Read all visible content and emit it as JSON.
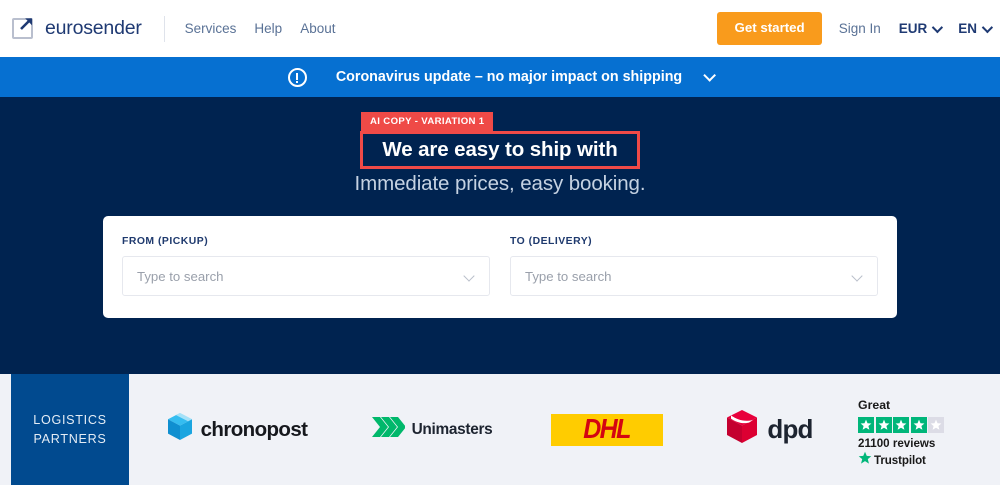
{
  "header": {
    "logo_text": "eurosender",
    "logo_icon": "arrow-out-of-box-icon",
    "nav": [
      {
        "label": "Services"
      },
      {
        "label": "Help"
      },
      {
        "label": "About"
      }
    ],
    "get_started_label": "Get started",
    "sign_in_label": "Sign In",
    "currency": {
      "value": "EUR",
      "icon": "chevron-down-icon"
    },
    "language": {
      "value": "EN",
      "icon": "chevron-down-icon"
    },
    "colors": {
      "cta": "#f99b1c",
      "brand_navy": "#1f3a73",
      "nav_link": "#5a7296"
    }
  },
  "banner": {
    "icon": "exclamation-circle-icon",
    "text": "Coronavirus update – no major impact on shipping",
    "expand_icon": "chevron-down-icon",
    "color": "#0670d1"
  },
  "hero": {
    "annotation_tag": "AI COPY - VARIATION 1",
    "annotation_color": "#ef4a47",
    "headline": "We are easy to ship with",
    "subtitle": "Immediate prices, easy booking.",
    "background": "#002350"
  },
  "search_form": {
    "fields": [
      {
        "label": "FROM (PICKUP)",
        "value": "",
        "placeholder": "Type to search",
        "icon": "chevron-down-icon"
      },
      {
        "label": "TO (DELIVERY)",
        "value": "",
        "placeholder": "Type to search",
        "icon": "chevron-down-icon"
      }
    ]
  },
  "partners": {
    "heading_line1": "LOGISTICS",
    "heading_line2": "PARTNERS",
    "heading_background": "#014a8f",
    "section_background": "#f0f2f7",
    "logos": [
      {
        "name": "chronopost",
        "label": "chronopost",
        "icon": "blue-cube-icon",
        "color": "#0f9ede"
      },
      {
        "name": "unimasters",
        "label": "Unimasters",
        "icon": "green-chevrons-icon",
        "color": "#00b86b"
      },
      {
        "name": "dhl",
        "label": "DHL",
        "icon": "dhl-wordmark-icon",
        "color": "#d40511",
        "background": "#ffcc00"
      },
      {
        "name": "dpd",
        "label": "dpd",
        "icon": "red-cube-icon",
        "color": "#dc0032"
      }
    ]
  },
  "trustpilot": {
    "rating_word": "Great",
    "stars_filled": 4,
    "stars_total": 5,
    "reviews_text": "21100 reviews",
    "brand_label": "Trustpilot",
    "brand_icon": "trustpilot-star-icon",
    "colors": {
      "star_on": "#00b67a",
      "star_off": "#dcdce6"
    }
  }
}
